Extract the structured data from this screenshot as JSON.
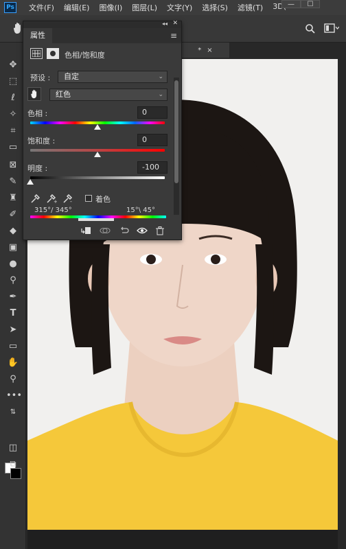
{
  "app": {
    "logo": "Ps"
  },
  "menu": [
    "文件(F)",
    "编辑(E)",
    "图像(I)",
    "图层(L)",
    "文字(Y)",
    "选择(S)",
    "滤镜(T)",
    "3D("
  ],
  "window_controls": {
    "minimize": "—",
    "maximize": "☐"
  },
  "options_bar": {
    "tool_icon": "hand-tool-icon",
    "search_icon": "search-icon",
    "workspace_icon": "workspace-icon"
  },
  "document_tab": {
    "suffix": "*",
    "close": "×"
  },
  "properties_panel": {
    "title": "属性",
    "adjustment_name": "色相/饱和度",
    "preset_label": "预设 :",
    "preset_value": "自定",
    "channel_value": "红色",
    "hue_label": "色相 :",
    "hue_value": "0",
    "saturation_label": "饱和度 :",
    "saturation_value": "0",
    "lightness_label": "明度 :",
    "lightness_value": "-100",
    "colorize_label": "着色",
    "colorize_checked": false,
    "range_left": "315°/ 345°",
    "range_right": "15°\\ 45°",
    "collapse": "◂◂",
    "close": "✕",
    "menu": "≡",
    "footer_icons": [
      "clip-to-layer-icon",
      "view-previous-icon",
      "reset-icon",
      "visibility-eye-icon",
      "trash-icon"
    ]
  },
  "slider_levels": {
    "hue": 0.5,
    "saturation": 0.5,
    "lightness": 0.0
  },
  "colors": {
    "accent_yellow": "#f5c83a",
    "panel_bg": "#3a3a3a",
    "app_bg": "#2f2f2f"
  }
}
